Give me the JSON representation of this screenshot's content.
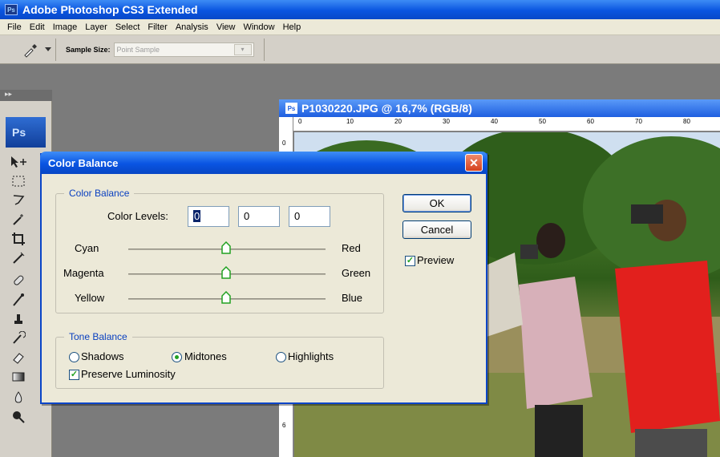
{
  "app": {
    "title": "Adobe Photoshop CS3 Extended",
    "badge": "Ps"
  },
  "menu": [
    "File",
    "Edit",
    "Image",
    "Layer",
    "Select",
    "Filter",
    "Analysis",
    "View",
    "Window",
    "Help"
  ],
  "options_bar": {
    "sample_size_label": "Sample Size:",
    "sample_size_value": "Point Sample"
  },
  "toolbox": {
    "logo": "Ps",
    "grip": "▸▸"
  },
  "document": {
    "title": "P1030220.JPG @ 16,7% (RGB/8)",
    "ruler_marks": [
      "0",
      "10",
      "20",
      "30",
      "40",
      "50",
      "60",
      "70",
      "80"
    ],
    "ruler_left_marks": [
      "0",
      "6"
    ]
  },
  "dialog": {
    "title": "Color Balance",
    "close_glyph": "✕",
    "color_balance_group": "Color Balance",
    "color_levels_label": "Color Levels:",
    "levels": [
      "0",
      "0",
      "0"
    ],
    "sliders": [
      {
        "left": "Cyan",
        "right": "Red",
        "value": 0
      },
      {
        "left": "Magenta",
        "right": "Green",
        "value": 0
      },
      {
        "left": "Yellow",
        "right": "Blue",
        "value": 0
      }
    ],
    "tone_balance_group": "Tone Balance",
    "tones": [
      {
        "label": "Shadows",
        "selected": false
      },
      {
        "label": "Midtones",
        "selected": true
      },
      {
        "label": "Highlights",
        "selected": false
      }
    ],
    "preserve_luminosity": {
      "label": "Preserve Luminosity",
      "checked": true
    },
    "ok_label": "OK",
    "cancel_label": "Cancel",
    "preview": {
      "label": "Preview",
      "checked": true
    },
    "check_glyph": "✓"
  },
  "colors": {
    "xp_blue": "#0a54e0",
    "dialog_bg": "#ece9d8",
    "legend_blue": "#0a40c0",
    "close_red": "#d4411d"
  }
}
